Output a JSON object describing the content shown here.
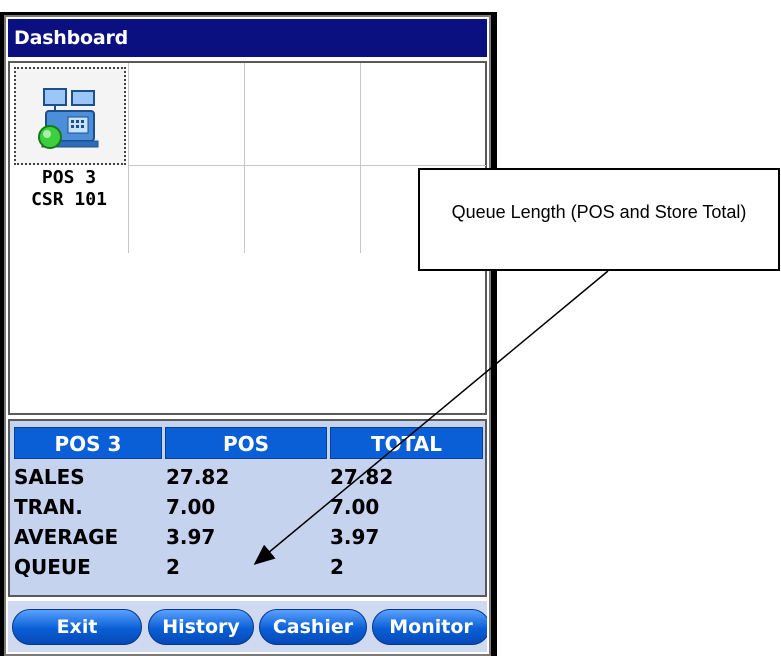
{
  "window": {
    "title": "Dashboard"
  },
  "tiles": [
    {
      "line1": "POS 3",
      "line2": "CSR 101",
      "icon": "cash-register-icon"
    }
  ],
  "stats": {
    "headers": [
      "POS 3",
      "POS",
      "TOTAL"
    ],
    "rows": [
      {
        "label": "SALES",
        "pos": "27.82",
        "total": "27.82"
      },
      {
        "label": "TRAN.",
        "pos": "7.00",
        "total": "7.00"
      },
      {
        "label": "AVERAGE",
        "pos": "3.97",
        "total": "3.97"
      },
      {
        "label": "QUEUE",
        "pos": "2",
        "total": "2"
      }
    ]
  },
  "buttons": {
    "exit": "Exit",
    "history": "History",
    "cashier": "Cashier",
    "monitor": "Monitor"
  },
  "annotation": {
    "text": "Queue Length (POS and Store Total)"
  },
  "colors": {
    "title_bar": "#0a1080",
    "header_blue": "#0a5fd6",
    "stats_bg": "#c6d3ee"
  }
}
